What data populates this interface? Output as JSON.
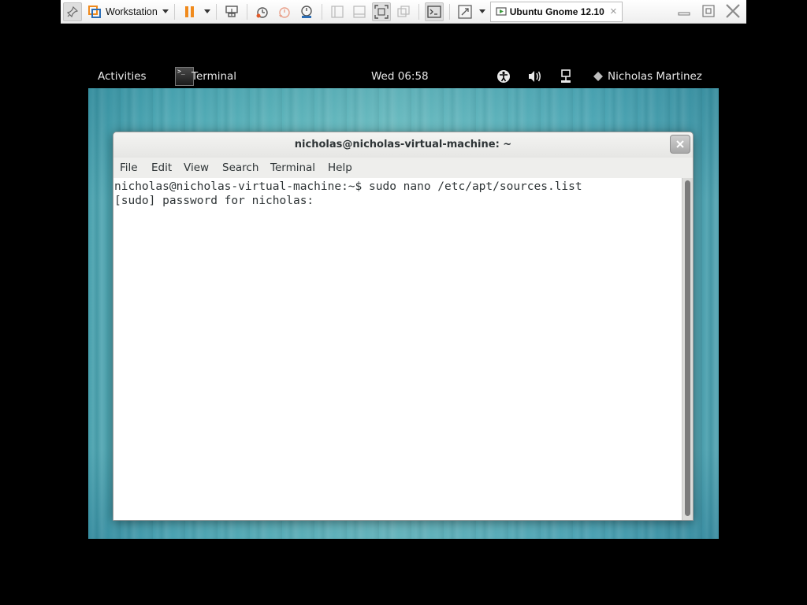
{
  "vmware_toolbar": {
    "product_label": "Workstation",
    "vm_tab_label": "Ubuntu Gnome 12.10",
    "tab_close_glyph": "×",
    "icons": [
      "pin-icon",
      "vmware-logo-icon",
      "pause-icon",
      "send-ctrl-alt-del-icon",
      "snapshot-icon",
      "revert-snapshot-icon",
      "snapshot-manager-icon",
      "show-library-icon",
      "thumbnail-bar-icon",
      "full-screen-icon",
      "unity-icon",
      "console-view-icon",
      "stretch-guest-icon"
    ],
    "accent_color": "#f08a1c"
  },
  "gnome_panel": {
    "activities": "Activities",
    "app_name": "Terminal",
    "app_icon_text": ">_",
    "clock": "Wed 06:58",
    "user_name": "Nicholas Martinez",
    "indicators": [
      "accessibility-icon",
      "volume-icon",
      "network-icon",
      "user-status-icon"
    ]
  },
  "terminal_window": {
    "title": "nicholas@nicholas-virtual-machine: ~",
    "close_glyph": "✕",
    "menu": {
      "file": "File",
      "edit": "Edit",
      "view": "View",
      "search": "Search",
      "terminal": "Terminal",
      "help": "Help"
    },
    "lines": [
      "nicholas@nicholas-virtual-machine:~$ sudo nano /etc/apt/sources.list",
      "[sudo] password for nicholas: "
    ]
  }
}
